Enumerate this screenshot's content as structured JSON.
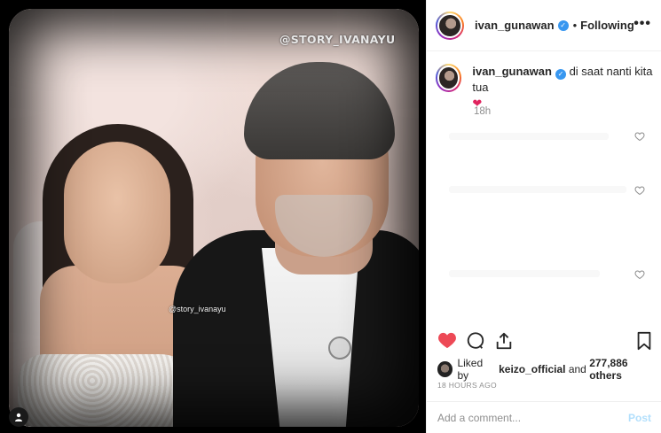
{
  "photo": {
    "watermark_top": "@STORY_IVANAYU",
    "watermark_mid": "@story_ivanayu",
    "tag_icon": "user-tag-icon"
  },
  "header": {
    "username": "ivan_gunawan",
    "separator": "•",
    "following_label": "Following",
    "more_label": "•••"
  },
  "caption": {
    "username": "ivan_gunawan",
    "text": "di saat nanti kita tua",
    "emoji": "❤",
    "time_ago": "18h"
  },
  "actions": {
    "like_icon": "heart-filled-icon",
    "comment_icon": "comment-icon",
    "share_icon": "share-icon",
    "save_icon": "bookmark-icon"
  },
  "likes": {
    "prefix": "Liked by",
    "user": "keizo_official",
    "and_label": "and",
    "count": "277,886 others"
  },
  "date": "18 HOURS AGO",
  "comment_box": {
    "placeholder": "Add a comment...",
    "post_label": "Post"
  },
  "colors": {
    "like_red": "#ed4956",
    "verified_blue": "#3897f0",
    "post_disabled": "#b2dffc"
  }
}
